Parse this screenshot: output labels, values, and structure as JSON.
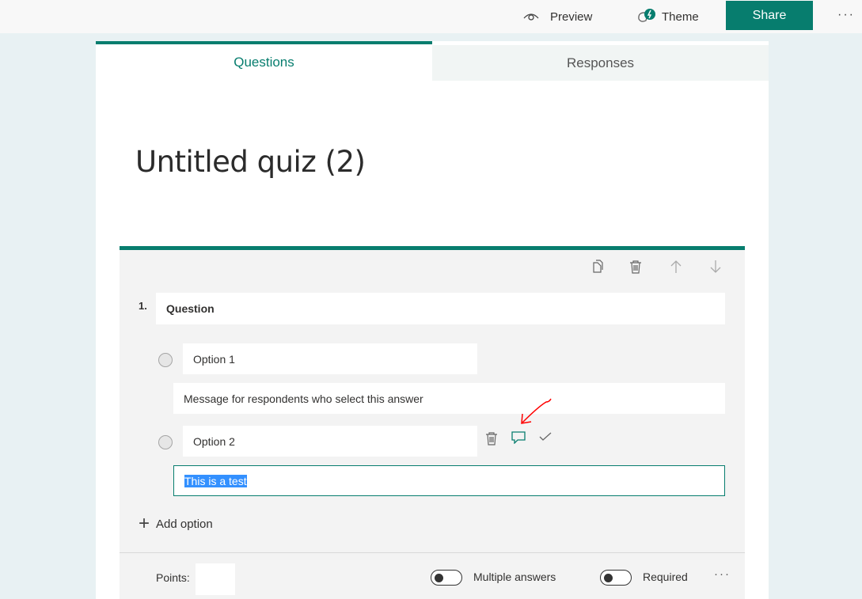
{
  "toolbar": {
    "preview_label": "Preview",
    "theme_label": "Theme",
    "share_label": "Share",
    "more_label": "···"
  },
  "tabs": [
    {
      "label": "Questions",
      "active": true
    },
    {
      "label": "Responses",
      "active": false
    }
  ],
  "form": {
    "title": "Untitled quiz (2)"
  },
  "question": {
    "number": "1.",
    "text": "Question",
    "options": [
      {
        "label": "Option 1",
        "message": "Message for respondents who select this answer"
      },
      {
        "label": "Option 2",
        "message": "This is a test"
      }
    ],
    "add_option_label": "Add option",
    "points_label": "Points:",
    "points_value": "",
    "multiple_answers_label": "Multiple answers",
    "multiple_answers_on": false,
    "required_label": "Required",
    "required_on": false,
    "more_label": "···"
  },
  "colors": {
    "accent": "#077d6e",
    "background": "#e8f1f3",
    "annotation": "#ff0000"
  },
  "icons": [
    "eye-icon",
    "theme-icon",
    "copy-icon",
    "trash-icon",
    "arrow-up-icon",
    "arrow-down-icon",
    "comment-icon",
    "check-icon",
    "plus-icon"
  ]
}
